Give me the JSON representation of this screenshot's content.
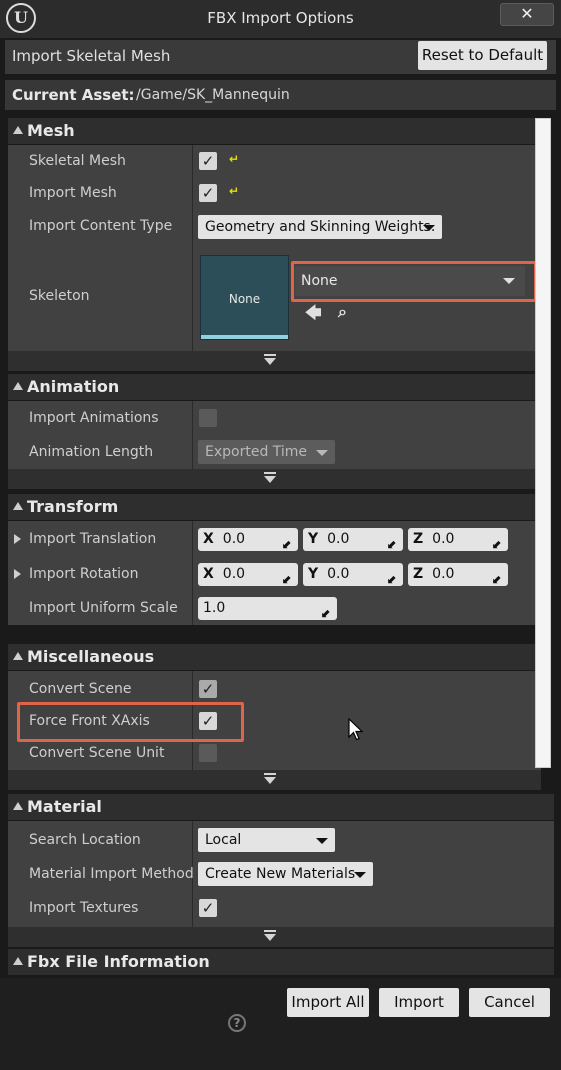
{
  "window": {
    "title": "FBX Import Options",
    "close_label": "✕"
  },
  "header": {
    "title": "Import Skeletal Mesh",
    "reset_label": "Reset to Default"
  },
  "asset": {
    "label": "Current Asset:",
    "path": "/Game/SK_Mannequin"
  },
  "mesh": {
    "title": "Mesh",
    "skeletal_mesh_label": "Skeletal Mesh",
    "import_mesh_label": "Import Mesh",
    "content_type_label": "Import Content Type",
    "content_type_value": "Geometry and Skinning Weights.",
    "skeleton_label": "Skeleton",
    "skeleton_thumb": "None",
    "skeleton_value": "None"
  },
  "animation": {
    "title": "Animation",
    "import_label": "Import Animations",
    "length_label": "Animation Length",
    "length_value": "Exported Time"
  },
  "transform": {
    "title": "Transform",
    "translation_label": "Import Translation",
    "rotation_label": "Import Rotation",
    "scale_label": "Import Uniform Scale",
    "translation": {
      "x": "0.0",
      "y": "0.0",
      "z": "0.0"
    },
    "rotation": {
      "x": "0.0",
      "y": "0.0",
      "z": "0.0"
    },
    "scale": "1.0",
    "axis_x": "X",
    "axis_y": "Y",
    "axis_z": "Z"
  },
  "misc": {
    "title": "Miscellaneous",
    "convert_scene_label": "Convert Scene",
    "force_front_label": "Force Front XAxis",
    "convert_unit_label": "Convert Scene Unit"
  },
  "material": {
    "title": "Material",
    "search_label": "Search Location",
    "search_value": "Local",
    "method_label": "Material Import Method",
    "method_value": "Create New Materials",
    "textures_label": "Import Textures"
  },
  "fbx_info": {
    "title": "Fbx File Information"
  },
  "footer": {
    "import_all": "Import All",
    "import": "Import",
    "cancel": "Cancel",
    "help": "?"
  },
  "colors": {
    "highlight": "#e06449",
    "panel": "#414141",
    "category": "#2e2e2e"
  }
}
